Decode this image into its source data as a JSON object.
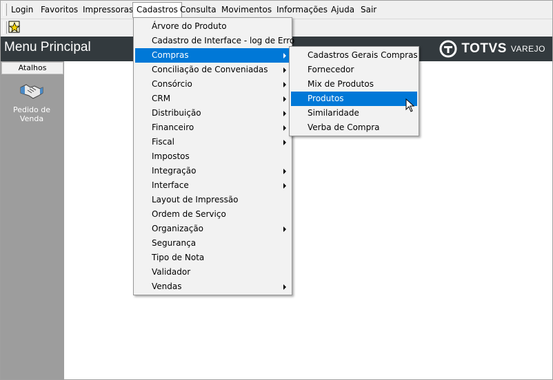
{
  "menubar": {
    "items": [
      {
        "label": "Login"
      },
      {
        "label": "Favoritos"
      },
      {
        "label": "Impressoras"
      },
      {
        "label": "Cadastros"
      },
      {
        "label": "Consulta"
      },
      {
        "label": "Movimentos"
      },
      {
        "label": "Informações"
      },
      {
        "label": "Ajuda"
      },
      {
        "label": "Sair"
      }
    ]
  },
  "header": {
    "title": "Menu Principal",
    "logo_brand": "TOTVS",
    "logo_sub": "VAREJO"
  },
  "sidebar": {
    "tab_label": "Atalhos",
    "shortcut_label": "Pedido de Venda"
  },
  "cadastros_menu": {
    "items": [
      {
        "label": "Árvore do Produto"
      },
      {
        "label": "Cadastro de Interface - log de Erro"
      },
      {
        "label": "Compras"
      },
      {
        "label": "Conciliação de Conveniadas"
      },
      {
        "label": "Consórcio"
      },
      {
        "label": "CRM"
      },
      {
        "label": "Distribuição"
      },
      {
        "label": "Financeiro"
      },
      {
        "label": "Fiscal"
      },
      {
        "label": "Impostos"
      },
      {
        "label": "Integração"
      },
      {
        "label": "Interface"
      },
      {
        "label": "Layout de Impressão"
      },
      {
        "label": "Ordem de Serviço"
      },
      {
        "label": "Organização"
      },
      {
        "label": "Segurança"
      },
      {
        "label": "Tipo de Nota"
      },
      {
        "label": "Validador"
      },
      {
        "label": "Vendas"
      }
    ]
  },
  "compras_menu": {
    "items": [
      {
        "label": "Cadastros Gerais Compras"
      },
      {
        "label": "Fornecedor"
      },
      {
        "label": "Mix de Produtos"
      },
      {
        "label": "Produtos"
      },
      {
        "label": "Similaridade"
      },
      {
        "label": "Verba de Compra"
      }
    ]
  },
  "colors": {
    "highlight": "#0078d7",
    "header_bg": "#333a3e",
    "sidebar_bg": "#9d9d9d"
  }
}
